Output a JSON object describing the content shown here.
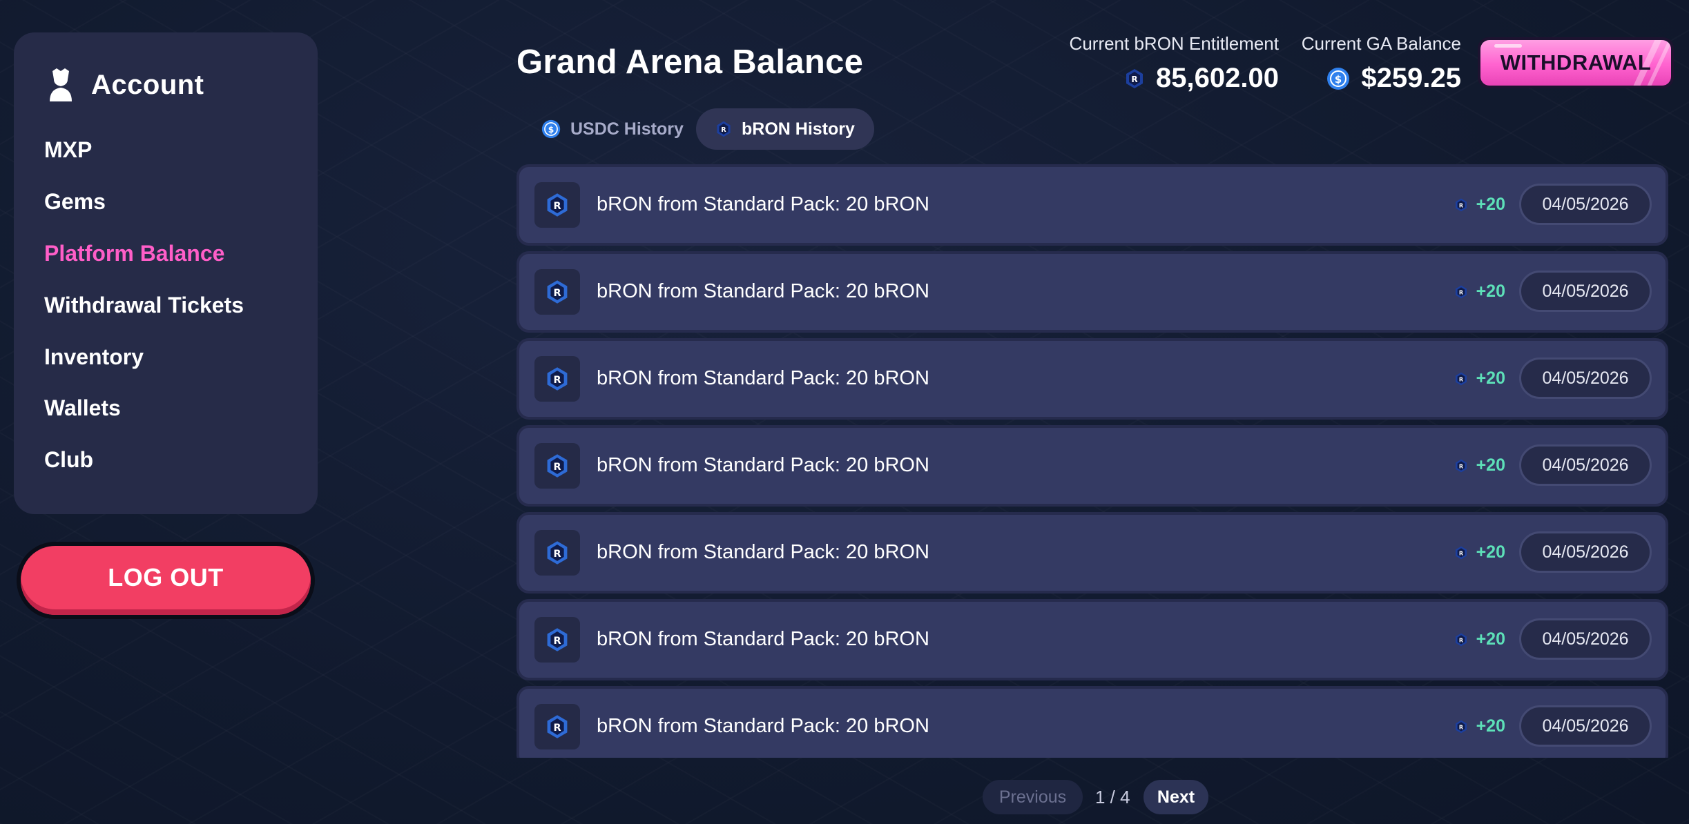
{
  "sidebar": {
    "title": "Account",
    "items": [
      {
        "label": "MXP"
      },
      {
        "label": "Gems"
      },
      {
        "label": "Platform Balance",
        "active": true
      },
      {
        "label": "Withdrawal Tickets"
      },
      {
        "label": "Inventory"
      },
      {
        "label": "Wallets"
      },
      {
        "label": "Club"
      }
    ],
    "logout_label": "LOG OUT"
  },
  "header": {
    "title": "Grand Arena Balance",
    "bron_entitlement_label": "Current bRON Entitlement",
    "bron_entitlement_value": "85,602.00",
    "ga_balance_label": "Current GA Balance",
    "ga_balance_value": "$259.25",
    "withdraw_label": "WITHDRAWAL"
  },
  "tabs": {
    "usdc": "USDC History",
    "bron": "bRON History",
    "active": "bRON History"
  },
  "history": [
    {
      "text": "bRON from Standard Pack: 20 bRON",
      "amount": "+20",
      "date": "04/05/2026"
    },
    {
      "text": "bRON from Standard Pack: 20 bRON",
      "amount": "+20",
      "date": "04/05/2026"
    },
    {
      "text": "bRON from Standard Pack: 20 bRON",
      "amount": "+20",
      "date": "04/05/2026"
    },
    {
      "text": "bRON from Standard Pack: 20 bRON",
      "amount": "+20",
      "date": "04/05/2026"
    },
    {
      "text": "bRON from Standard Pack: 20 bRON",
      "amount": "+20",
      "date": "04/05/2026"
    },
    {
      "text": "bRON from Standard Pack: 20 bRON",
      "amount": "+20",
      "date": "04/05/2026"
    },
    {
      "text": "bRON from Standard Pack: 20 bRON",
      "amount": "+20",
      "date": "04/05/2026"
    }
  ],
  "pagination": {
    "previous": "Previous",
    "status": "1 / 4",
    "next": "Next"
  },
  "colors": {
    "accent_pink": "#ff5ec8",
    "logout_red": "#f23e63",
    "positive_green": "#5de0b8",
    "bron_blue": "#2e6bd6",
    "usdc_blue": "#2f80ed"
  },
  "icons": {
    "account": "account-icon",
    "bron": "bron-token-icon",
    "usdc": "usdc-coin-icon"
  }
}
